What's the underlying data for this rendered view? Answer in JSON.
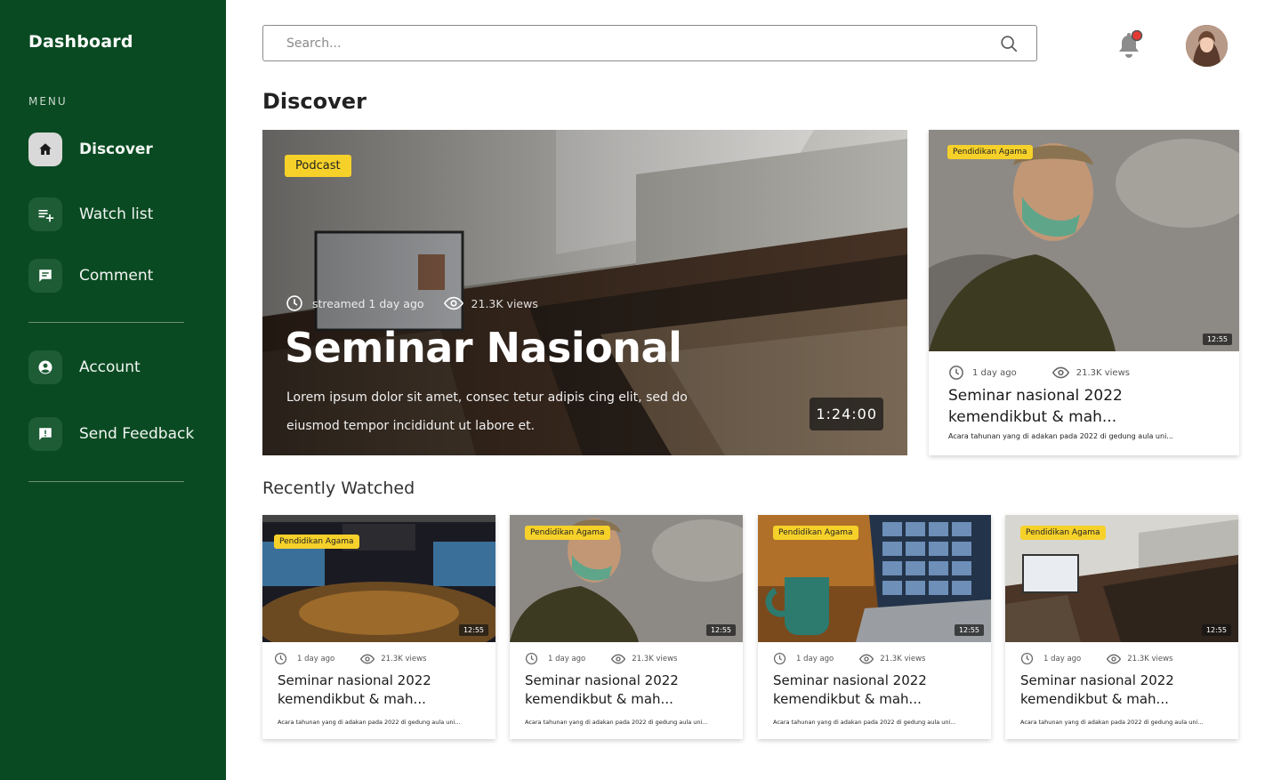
{
  "sidebar": {
    "brand": "Dashboard",
    "menu_label": "MENU",
    "items": [
      {
        "label": "Discover",
        "icon": "home-icon",
        "active": true
      },
      {
        "label": "Watch list",
        "icon": "playlist-add-icon"
      },
      {
        "label": "Comment",
        "icon": "comment-icon"
      },
      {
        "label": "Account",
        "icon": "account-icon"
      },
      {
        "label": "Send Feedback",
        "icon": "feedback-icon"
      }
    ]
  },
  "header": {
    "search_placeholder": "Search...",
    "notification_dot_color": "#e53935"
  },
  "discover": {
    "title": "Discover",
    "hero": {
      "tag": "Podcast",
      "streamed": "streamed 1 day ago",
      "views": "21.3K views",
      "title": "Seminar Nasional",
      "description": "Lorem ipsum dolor sit amet, consec tetur adipis cing elit, sed do eiusmod tempor incididunt ut labore et.",
      "duration": "1:24:00"
    },
    "side_card": {
      "tag": "Pendidikan Agama",
      "duration": "12:55",
      "time": "1 day ago",
      "views": "21.3K views",
      "title_line1": "Seminar nasional 2022",
      "title_line2": "kemendikbut & mah...",
      "description": "Acara tahunan yang di adakan pada 2022 di gedung aula uni..."
    }
  },
  "recent": {
    "title": "Recently Watched",
    "cards": [
      {
        "tag": "Pendidikan Agama",
        "duration": "12:55",
        "time": "1 day ago",
        "views": "21.3K views",
        "title_line1": "Seminar nasional 2022",
        "title_line2": "kemendikbut & mah...",
        "description": "Acara tahunan yang di adakan pada 2022 di gedung aula uni..."
      },
      {
        "tag": "Pendidikan Agama",
        "duration": "12:55",
        "time": "1 day ago",
        "views": "21.3K views",
        "title_line1": "Seminar nasional 2022",
        "title_line2": "kemendikbut & mah...",
        "description": "Acara tahunan yang di adakan pada 2022 di gedung aula uni..."
      },
      {
        "tag": "Pendidikan Agama",
        "duration": "12:55",
        "time": "1 day ago",
        "views": "21.3K views",
        "title_line1": "Seminar nasional 2022",
        "title_line2": "kemendikbut & mah...",
        "description": "Acara tahunan yang di adakan pada 2022 di gedung aula uni..."
      },
      {
        "tag": "Pendidikan Agama",
        "duration": "12:55",
        "time": "1 day ago",
        "views": "21.3K views",
        "title_line1": "Seminar nasional 2022",
        "title_line2": "kemendikbut & mah...",
        "description": "Acara tahunan yang di adakan pada 2022 di gedung aula uni..."
      }
    ]
  },
  "colors": {
    "sidebar_bg": "#0a4a22",
    "tag_bg": "#f6d12a"
  }
}
